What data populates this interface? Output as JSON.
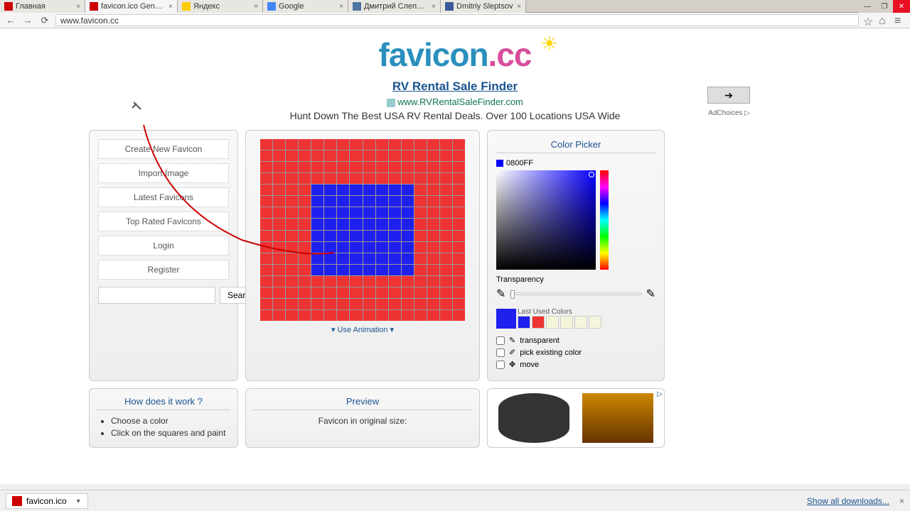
{
  "tabs": [
    {
      "title": "Главная"
    },
    {
      "title": "favicon.ico Generato"
    },
    {
      "title": "Яндекс"
    },
    {
      "title": "Google"
    },
    {
      "title": "Дмитрий Слепцов"
    },
    {
      "title": "Dmitriy Sleptsov"
    }
  ],
  "active_tab": 1,
  "address": "www.favicon.cc",
  "logo": {
    "prefix": "favicon",
    "suffix": ".cc"
  },
  "ad": {
    "title": "RV Rental Sale Finder",
    "url": "www.RVRentalSaleFinder.com",
    "desc": "Hunt Down The Best USA RV Rental Deals. Over 100 Locations USA Wide",
    "adchoices": "AdChoices ▷"
  },
  "menu": {
    "create": "Create New Favicon",
    "import": "Import Image",
    "latest": "Latest Favicons",
    "top": "Top Rated Favicons",
    "login": "Login",
    "register": "Register",
    "search_btn": "Search"
  },
  "grid": {
    "anim": "▾ Use Animation ▾",
    "blue_region": {
      "row_start": 4,
      "row_end": 11,
      "col_start": 4,
      "col_end": 11
    }
  },
  "picker": {
    "title": "Color Picker",
    "hex": "0800FF",
    "transparency": "Transparency",
    "last_used": "Last Used Colors",
    "swatches": [
      "#2020ee",
      "#ee3333",
      "#f5f5dc",
      "#f5f5dc",
      "#f5f5dc",
      "#f5f5dc"
    ],
    "opt_transparent": "transparent",
    "opt_pick": "pick existing color",
    "opt_move": "move"
  },
  "how": {
    "title": "How does it work ?",
    "items": [
      "Choose a color",
      "Click on the squares and paint"
    ]
  },
  "preview": {
    "title": "Preview",
    "text": "Favicon in original size:"
  },
  "download": {
    "file": "favicon.ico",
    "show_all": "Show all downloads..."
  }
}
